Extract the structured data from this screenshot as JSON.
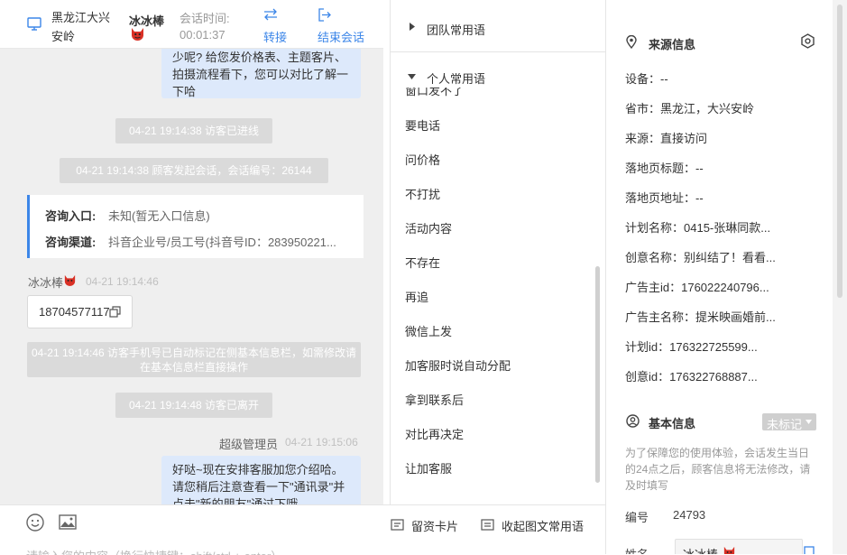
{
  "header": {
    "location": "黑龙江大兴安岭",
    "visitor_name": "冰冰棒",
    "session_time_label": "会话时间:",
    "session_time_value": "00:01:37",
    "transfer_label": "转接",
    "end_session_label": "结束会话"
  },
  "chat": {
    "msg_top_partial": "少呢? 给您发价格表、主题客片、拍摄流程看下，您可以对比了解一下哈",
    "sys1": "04-21 19:14:38 访客已进线",
    "sys2": "04-21 19:14:38 顾客发起会话，会话编号：26144",
    "consult_entry_label": "咨询入口:",
    "consult_entry_value": "未知(暂无入口信息)",
    "consult_channel_label": "咨询渠道:",
    "consult_channel_value": "抖音企业号/员工号(抖音号ID：283950221...",
    "visitor_msg_name": "冰冰棒",
    "visitor_msg_time": "04-21 19:14:46",
    "visitor_msg_text": "18704577117",
    "sys3": "04-21 19:14:46 访客手机号已自动标记在侧基本信息栏，如需修改请在基本信息栏直接操作",
    "sys4": "04-21 19:14:48 访客已离开",
    "agent_name": "超级管理员",
    "agent_time": "04-21 19:15:06",
    "agent_msg": "好哒~现在安排客服加您介绍哈。请您稍后注意查看一下\"通讯录\"并点击\"新的朋友\"通过下哦"
  },
  "composer": {
    "leave_card_label": "留资卡片",
    "collect_label": "收起图文常用语",
    "placeholder": "请输入您的内容（换行快捷键：shift/ctrl + enter）"
  },
  "phrases": {
    "team_label": "团队常用语",
    "personal_label": "个人常用语",
    "partial_item": "窗口发不了",
    "items": [
      "要电话",
      "问价格",
      "不打扰",
      "活动内容",
      "不存在",
      "再追",
      "微信上发",
      "加客服时说自动分配",
      "拿到联系后",
      "对比再决定",
      "让加客服"
    ]
  },
  "info": {
    "source_title": "来源信息",
    "rows": [
      "设备：--",
      "省市：黑龙江，大兴安岭",
      "来源：直接访问",
      "落地页标题：--",
      "落地页地址：--",
      "计划名称：0415-张琳同款...",
      "创意名称：别纠结了！看看...",
      "广告主id：176022240796...",
      "广告主名称：提米映画婚前...",
      "计划id：176322725599...",
      "创意id：176322768887..."
    ],
    "basic_title": "基本信息",
    "tag_label": "未标记",
    "notice": "为了保障您的使用体验，会话发生当日的24点之后，顾客信息将无法修改，请及时填写",
    "number_label": "编号",
    "number_value": "24793",
    "name_label": "姓名",
    "name_value": "冰冰棒"
  },
  "colors": {
    "accent": "#3c86e8",
    "system_msg_bg": "#dadada",
    "my_bubble_bg": "#dde9fb",
    "chat_bg": "#efefef"
  },
  "icons": [
    "monitor-icon",
    "devil-emoji-icon",
    "transfer-icon",
    "exit-icon",
    "caret-right-icon",
    "caret-down-icon",
    "location-pin-icon",
    "settings-hex-icon",
    "user-circle-icon",
    "copy-icon",
    "emoji-icon",
    "image-icon",
    "card-icon",
    "edit-icon"
  ]
}
